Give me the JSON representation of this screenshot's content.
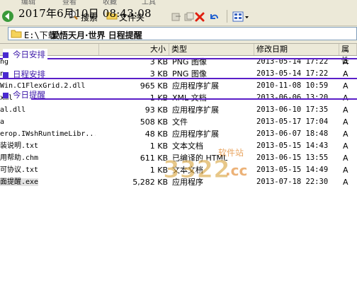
{
  "menubar": {
    "items": [
      "编辑",
      "查看",
      "收藏",
      "工具"
    ]
  },
  "clock": {
    "text": "2017年6月10日    08:43:08"
  },
  "toolbar": {
    "search_label": "搜索",
    "folders_label": "文件夹"
  },
  "address": {
    "path": "E:\\下载\\",
    "overlay": "爱悟天月·世界 日程提醒"
  },
  "columns": {
    "size": "大小",
    "type": "类型",
    "modified": "修改日期",
    "attr": "属性"
  },
  "rows": [
    {
      "name": "ng",
      "size": "3 KB",
      "type": "PNG 图像",
      "modified": "2013-05-14 17:22",
      "attr": "A"
    },
    {
      "name": "n",
      "size": "3 KB",
      "type": "PNG 图像",
      "modified": "2013-05-14 17:22",
      "attr": "A"
    },
    {
      "name": "Win.C1FlexGrid.2.dll",
      "size": "965 KB",
      "type": "应用程序扩展",
      "modified": "2010-11-08 10:59",
      "attr": "A"
    },
    {
      "name": "xml",
      "size": "1 KB",
      "type": "XML 文档",
      "modified": "2013-06-06 13:20",
      "attr": "A"
    },
    {
      "name": "al.dll",
      "size": "93 KB",
      "type": "应用程序扩展",
      "modified": "2013-06-10 17:35",
      "attr": "A"
    },
    {
      "name": "a",
      "size": "508 KB",
      "type": "文件",
      "modified": "2013-05-17 17:04",
      "attr": "A"
    },
    {
      "name": "erop.IWshRuntimeLibr...",
      "size": "48 KB",
      "type": "应用程序扩展",
      "modified": "2013-06-07 18:48",
      "attr": "A"
    },
    {
      "name": "装说明.txt",
      "size": "1 KB",
      "type": "文本文档",
      "modified": "2013-05-15 14:43",
      "attr": "A"
    },
    {
      "name": "用帮助.chm",
      "size": "611 KB",
      "type": "已编译的 HTML",
      "modified": "2013-06-15 13:55",
      "attr": "A"
    },
    {
      "name": "可协议.txt",
      "size": "1 KB",
      "type": "文本文档",
      "modified": "2013-05-15 14:49",
      "attr": "A"
    },
    {
      "name": "面提醒.exe",
      "size": "5,282 KB",
      "type": "应用程序",
      "modified": "2013-07-18 22:30",
      "attr": "A"
    }
  ],
  "overlays": [
    "今日安排",
    "日程安排",
    "今日提醒"
  ],
  "watermark": {
    "text": "软件站",
    "domain": ".cc",
    "number": "3322"
  },
  "colors": {
    "overlay": "#5a1ec8",
    "toolbar_bg": "#ece9d8",
    "watermark": "#d8a23a"
  },
  "icons": [
    "back-icon",
    "forward-icon",
    "search-icon",
    "folders-icon",
    "move-icon",
    "copy-icon",
    "delete-icon",
    "undo-icon",
    "views-icon",
    "folder-icon"
  ]
}
